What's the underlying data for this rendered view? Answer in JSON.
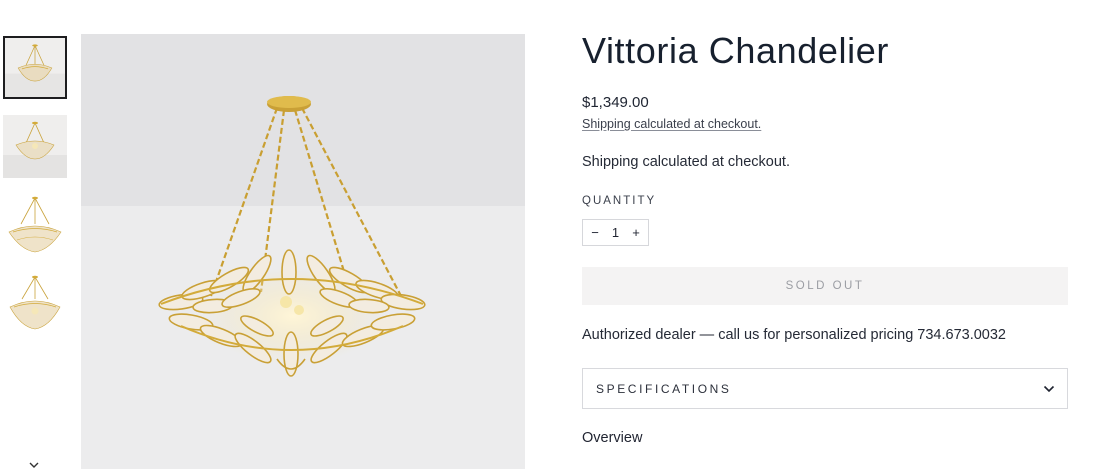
{
  "product": {
    "title": "Vittoria Chandelier",
    "price": "$1,349.00",
    "shipping_note_small": "Shipping calculated at checkout.",
    "shipping_note": "Shipping calculated at checkout."
  },
  "quantity": {
    "label": "QUANTITY",
    "value": "1",
    "decrement": "−",
    "increment": "+"
  },
  "buy": {
    "sold_out_label": "SOLD OUT"
  },
  "dealer_note": "Authorized dealer — call us for personalized pricing 734.673.0032",
  "specifications": {
    "label": "SPECIFICATIONS",
    "icon": "chevron-down-icon"
  },
  "overview": {
    "heading": "Overview"
  },
  "gallery": {
    "thumbnails": [
      {
        "active": true
      },
      {
        "active": false
      },
      {
        "active": false
      },
      {
        "active": false
      }
    ],
    "more_icon": "chevron-down-icon"
  },
  "colors": {
    "gold": "#d3ab3a",
    "text": "#1f2330",
    "sold_out_bg": "#f4f3f3",
    "sold_out_text": "#9b9da3",
    "border": "#d6d7db"
  }
}
